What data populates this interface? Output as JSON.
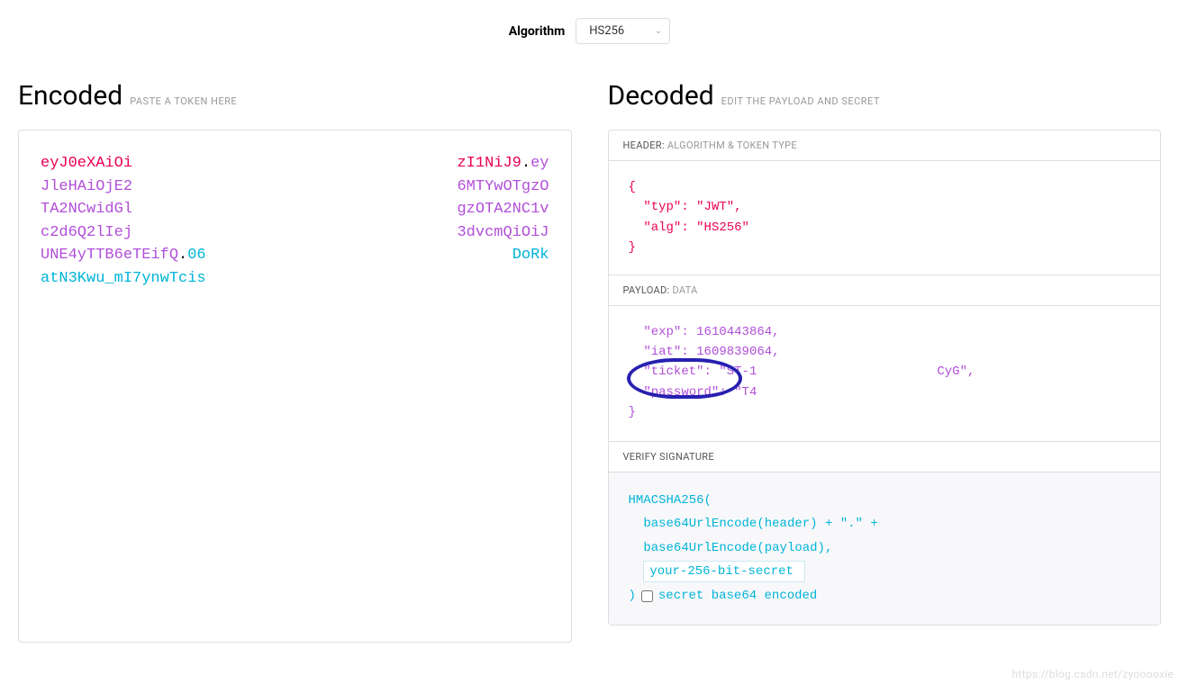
{
  "algorithm": {
    "label": "Algorithm",
    "value": "HS256"
  },
  "encoded": {
    "title": "Encoded",
    "subtitle": "PASTE A TOKEN HERE",
    "lines": [
      {
        "left": {
          "text": "eyJ0eXAiOi",
          "cls": "tok-red"
        },
        "right": {
          "text": "zI1NiJ9",
          "cls": "tok-red"
        },
        "dot": ".",
        "after": {
          "text": "ey",
          "cls": "tok-purple"
        }
      },
      {
        "left": {
          "text": "JleHAiOjE2",
          "cls": "tok-purple"
        },
        "right": {
          "text": "6MTYwOTgzO",
          "cls": "tok-purple"
        }
      },
      {
        "left": {
          "text": "TA2NCwidGl",
          "cls": "tok-purple"
        },
        "right": {
          "text": "gzOTA2NC1v",
          "cls": "tok-purple"
        }
      },
      {
        "left": {
          "text": "c2d6Q2lIej",
          "cls": "tok-purple"
        },
        "right": {
          "text": "3dvcmQiOiJ",
          "cls": "tok-purple"
        }
      },
      {
        "left": {
          "text": "UNE4yTTB6eTEifQ",
          "cls": "tok-purple"
        },
        "dot2": ".",
        "mid": {
          "text": "06",
          "cls": "tok-cyan"
        },
        "right": {
          "text": "DoRk",
          "cls": "tok-cyan"
        }
      },
      {
        "full": {
          "text": "atN3Kwu_mI7ynwTcis",
          "cls": "tok-cyan"
        }
      }
    ]
  },
  "decoded": {
    "title": "Decoded",
    "subtitle": "EDIT THE PAYLOAD AND SECRET",
    "header": {
      "label": "HEADER:",
      "sub": "ALGORITHM & TOKEN TYPE",
      "json": {
        "open": "{",
        "line1_key": "\"typ\"",
        "line1_val": "\"JWT\"",
        "line2_key": "\"alg\"",
        "line2_val": "\"HS256\"",
        "close": "}"
      }
    },
    "payload": {
      "label": "PAYLOAD:",
      "sub": "DATA",
      "json": {
        "line1_key": "\"exp\"",
        "line1_val": "1610443864",
        "line2_key": "\"iat\"",
        "line2_val": "1609839064",
        "line3_key": "\"ticket\"",
        "line3_val_start": "\"ST-1",
        "line3_val_end": "CyG\"",
        "line4_key": "\"password\"",
        "line4_val": "\"T4",
        "close": "}"
      }
    },
    "signature": {
      "label": "VERIFY SIGNATURE",
      "fn": "HMACSHA256(",
      "l1": "base64UrlEncode(header) + \".\" +",
      "l2": "base64UrlEncode(payload),",
      "secret_placeholder": "your-256-bit-secret",
      "close_paren": ")",
      "chk_label": "secret base64 encoded"
    }
  },
  "watermark": "https://blog.csdn.net/zyooooxie"
}
